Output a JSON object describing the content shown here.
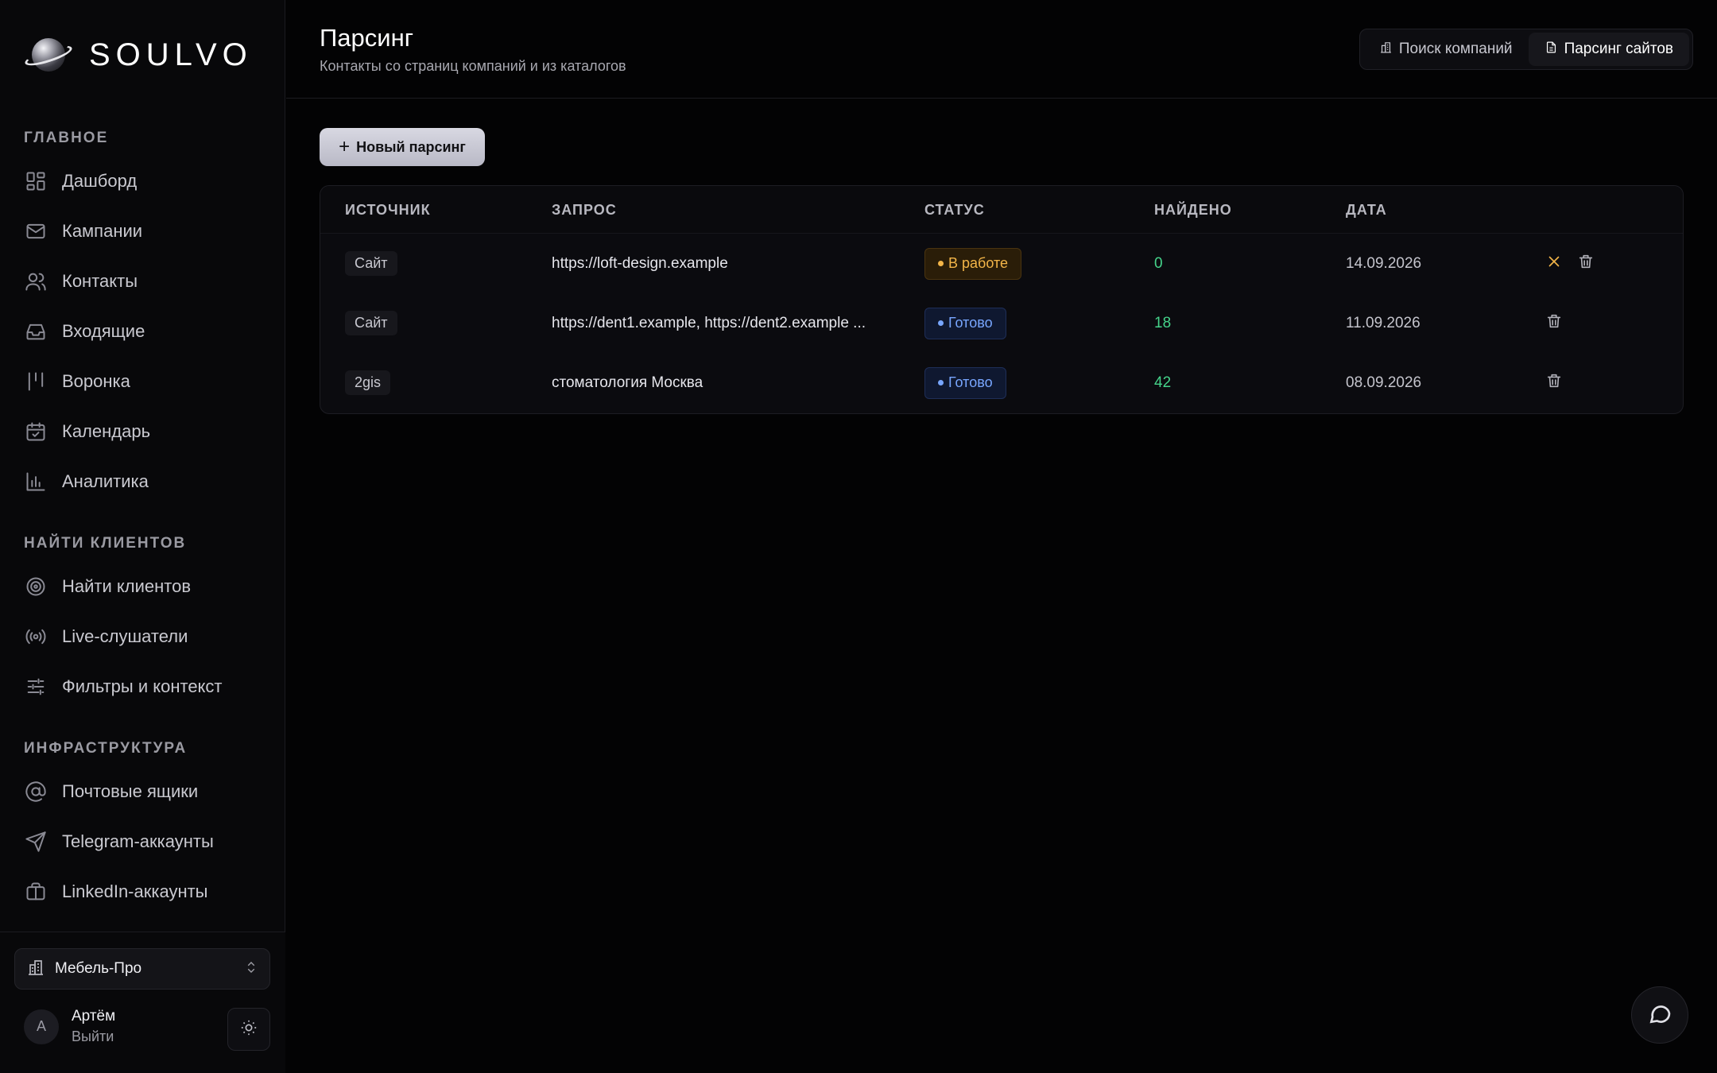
{
  "brand": {
    "name": "SOULVO"
  },
  "sidebar": {
    "sections": [
      {
        "title": "ГЛАВНОЕ"
      },
      {
        "title": "НАЙТИ КЛИЕНТОВ"
      },
      {
        "title": "ИНФРАСТРУКТУРА"
      }
    ],
    "items": [
      {
        "label": "Дашборд",
        "icon": "dashboard-icon"
      },
      {
        "label": "Кампании",
        "icon": "mail-icon"
      },
      {
        "label": "Контакты",
        "icon": "users-icon"
      },
      {
        "label": "Входящие",
        "icon": "inbox-icon"
      },
      {
        "label": "Воронка",
        "icon": "funnel-icon"
      },
      {
        "label": "Календарь",
        "icon": "calendar-icon"
      },
      {
        "label": "Аналитика",
        "icon": "chart-icon"
      },
      {
        "label": "Найти клиентов",
        "icon": "target-icon"
      },
      {
        "label": "Live-слушатели",
        "icon": "broadcast-icon"
      },
      {
        "label": "Фильтры и контекст",
        "icon": "sliders-icon"
      },
      {
        "label": "Почтовые ящики",
        "icon": "at-icon"
      },
      {
        "label": "Telegram-аккаунты",
        "icon": "send-icon"
      },
      {
        "label": "LinkedIn-аккаунты",
        "icon": "briefcase-icon"
      }
    ],
    "workspace": "Мебель-Про",
    "user": {
      "initial": "А",
      "name": "Артём",
      "logout": "Выйти"
    }
  },
  "header": {
    "title": "Парсинг",
    "subtitle": "Контакты со страниц компаний и из каталогов",
    "tabs": [
      {
        "label": "Поиск компаний",
        "active": false
      },
      {
        "label": "Парсинг сайтов",
        "active": true
      }
    ]
  },
  "actions": {
    "new_parsing": "Новый парсинг"
  },
  "table": {
    "columns": [
      "ИСТОЧНИК",
      "ЗАПРОС",
      "СТАТУС",
      "НАЙДЕНО",
      "ДАТА"
    ],
    "rows": [
      {
        "source": "Сайт",
        "query": "https://loft-design.example",
        "status": "В работе",
        "found": "0",
        "date": "14.09.2026"
      },
      {
        "source": "Сайт",
        "query": "https://dent1.example, https://dent2.example ...",
        "status": "Готово",
        "found": "18",
        "date": "11.09.2026"
      },
      {
        "source": "2gis",
        "query": "стоматология Москва",
        "status": "Готово",
        "found": "42",
        "date": "08.09.2026"
      }
    ]
  },
  "colors": {
    "status_working": "#f3b548",
    "status_done": "#78a6ff",
    "found": "#45d38a"
  }
}
